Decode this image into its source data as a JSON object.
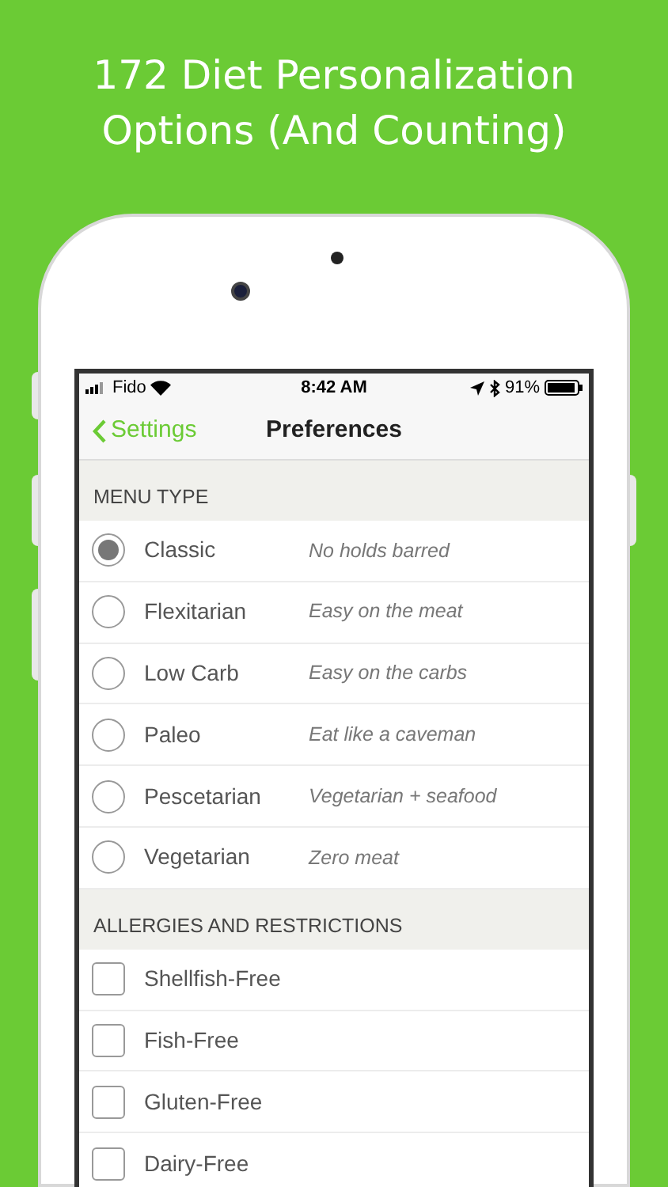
{
  "headline": [
    "172 Diet Personalization",
    "Options (And Counting)"
  ],
  "status_bar": {
    "carrier": "Fido",
    "time": "8:42 AM",
    "battery": "91%"
  },
  "nav": {
    "back": "Settings",
    "title": "Preferences"
  },
  "menu_type": {
    "header": "MENU TYPE",
    "options": [
      {
        "label": "Classic",
        "description": "No holds barred",
        "selected": true
      },
      {
        "label": "Flexitarian",
        "description": "Easy on the meat",
        "selected": false
      },
      {
        "label": "Low Carb",
        "description": "Easy on the carbs",
        "selected": false
      },
      {
        "label": "Paleo",
        "description": "Eat like a caveman",
        "selected": false
      },
      {
        "label": "Pescetarian",
        "description": "Vegetarian + seafood",
        "selected": false
      },
      {
        "label": "Vegetarian",
        "description": "Zero meat",
        "selected": false
      }
    ]
  },
  "allergies": {
    "header": "ALLERGIES AND RESTRICTIONS",
    "options": [
      {
        "label": "Shellfish-Free",
        "checked": false
      },
      {
        "label": "Fish-Free",
        "checked": false
      },
      {
        "label": "Gluten-Free",
        "checked": false
      },
      {
        "label": "Dairy-Free",
        "checked": false
      }
    ]
  }
}
